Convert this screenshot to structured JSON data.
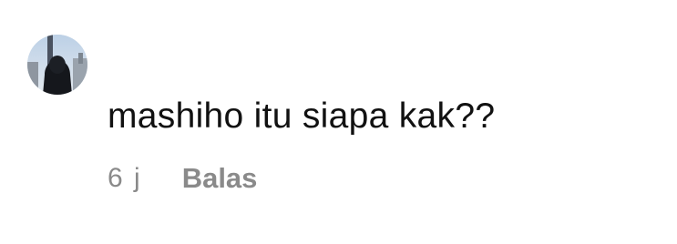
{
  "comment": {
    "avatar_icon": "user-avatar-photo",
    "text": "mashiho itu siapa kak??",
    "time": "6 j",
    "reply_label": "Balas"
  },
  "colors": {
    "text": "#111111",
    "meta": "#8a8a8a",
    "background": "#ffffff"
  }
}
